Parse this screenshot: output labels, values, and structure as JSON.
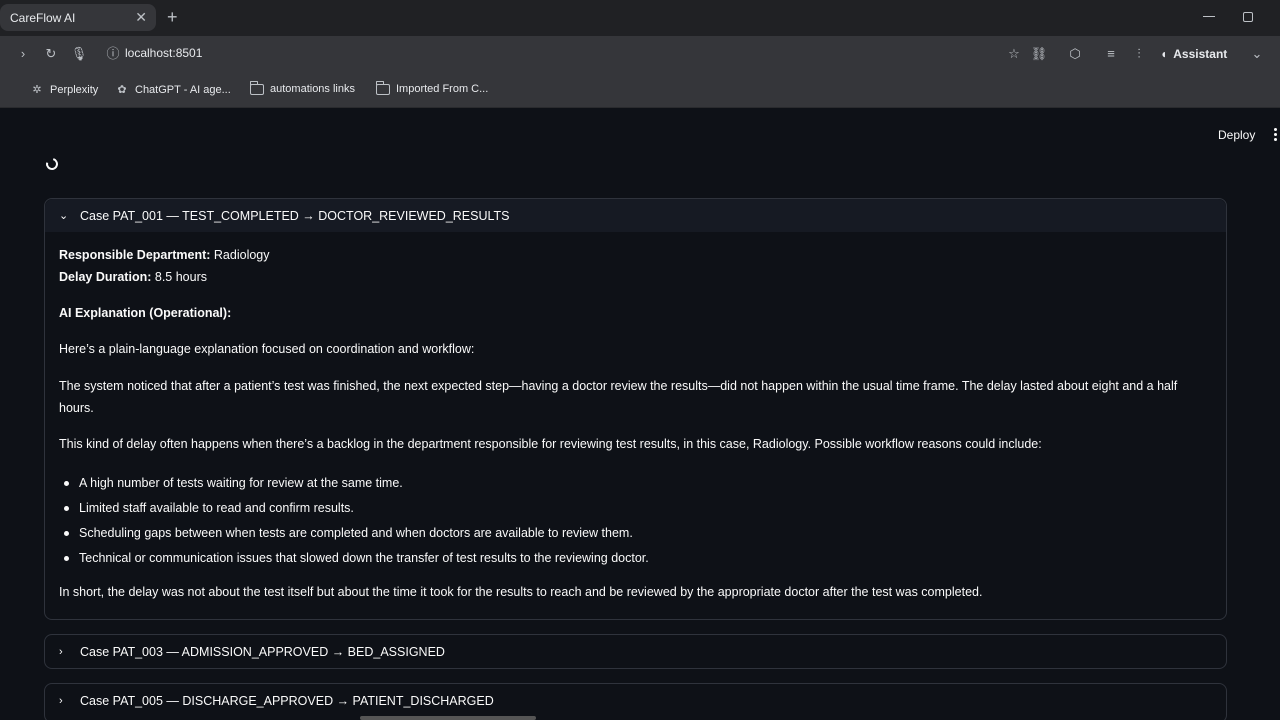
{
  "browser": {
    "tab_title": "CareFlow AI",
    "url": "localhost:8501",
    "assistant_label": "Assistant",
    "bookmarks": [
      {
        "label": "Perplexity",
        "icon": "perplexity-icon"
      },
      {
        "label": "ChatGPT - AI age...",
        "icon": "chatgpt-icon"
      },
      {
        "label": "automations links",
        "icon": "folder-icon"
      },
      {
        "label": "Imported From C...",
        "icon": "folder-icon"
      }
    ]
  },
  "app": {
    "deploy_label": "Deploy",
    "cases": [
      {
        "title": "Case PAT_001 — TEST_COMPLETED → DOCTOR_REVIEWED_RESULTS",
        "expanded": true,
        "department_label": "Responsible Department:",
        "department_value": "Radiology",
        "delay_label": "Delay Duration:",
        "delay_value": "8.5 hours",
        "explanation_heading": "AI Explanation (Operational):",
        "intro": "Here’s a plain-language explanation focused on coordination and workflow:",
        "para1": "The system noticed that after a patient’s test was finished, the next expected step—having a doctor review the results—did not happen within the usual time frame. The delay lasted about eight and a half hours.",
        "para2": "This kind of delay often happens when there’s a backlog in the department responsible for reviewing test results, in this case, Radiology. Possible workflow reasons could include:",
        "reasons": [
          "A high number of tests waiting for review at the same time.",
          "Limited staff available to read and confirm results.",
          "Scheduling gaps between when tests are completed and when doctors are available to review them.",
          "Technical or communication issues that slowed down the transfer of test results to the reviewing doctor."
        ],
        "summary": "In short, the delay was not about the test itself but about the time it took for the results to reach and be reviewed by the appropriate doctor after the test was completed."
      },
      {
        "title": "Case PAT_003 — ADMISSION_APPROVED → BED_ASSIGNED",
        "expanded": false
      },
      {
        "title": "Case PAT_005 — DISCHARGE_APPROVED → PATIENT_DISCHARGED",
        "expanded": false
      }
    ]
  }
}
